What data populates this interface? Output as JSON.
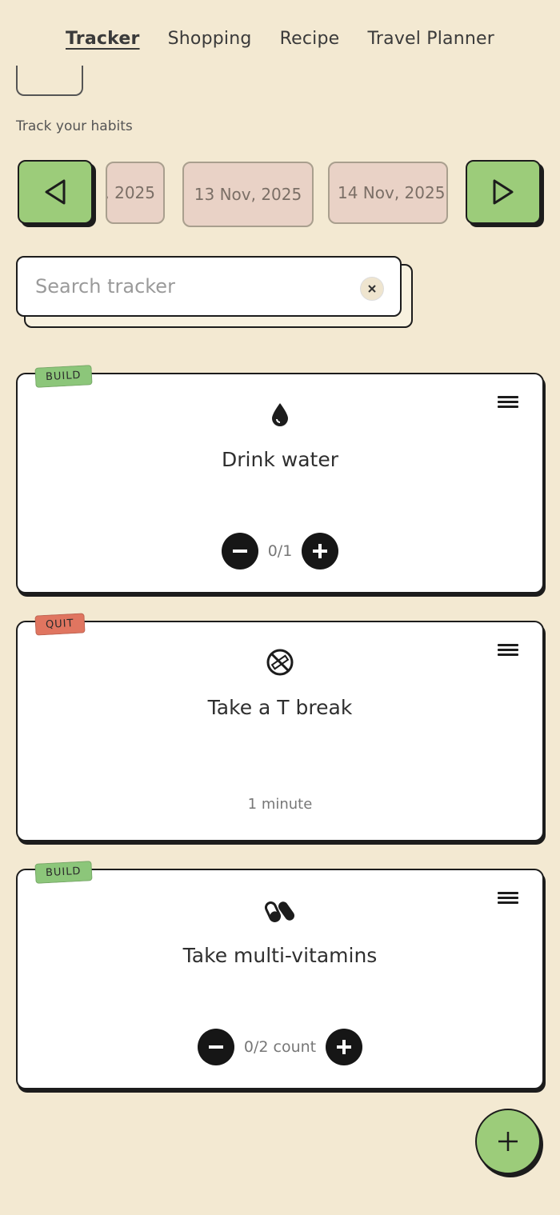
{
  "nav": {
    "tabs": [
      {
        "label": "Tracker",
        "active": true
      },
      {
        "label": "Shopping",
        "active": false
      },
      {
        "label": "Recipe",
        "active": false
      },
      {
        "label": "Travel Planner",
        "active": false
      }
    ]
  },
  "subtitle": "Track your habits",
  "date_strip": {
    "prev_icon": "triangle-left-icon",
    "next_icon": "triangle-right-icon",
    "dates": [
      ", 2025",
      "13 Nov, 2025",
      "14 Nov, 2025"
    ]
  },
  "search": {
    "placeholder": "Search tracker",
    "value": ""
  },
  "habits": [
    {
      "tag": "BUILD",
      "icon": "water-drop-icon",
      "title": "Drink water",
      "progress": "0/1"
    },
    {
      "tag": "QUIT",
      "icon": "no-smoking-icon",
      "title": "Take a T break",
      "duration": "1 minute"
    },
    {
      "tag": "BUILD",
      "icon": "pills-icon",
      "title": "Take multi-vitamins",
      "progress": "0/2 count"
    }
  ],
  "colors": {
    "background": "#f3e9d2",
    "accent_green": "#9ccc7a",
    "build_tag": "#8cc67a",
    "quit_tag": "#e07560",
    "date_chip": "#e9d2c6"
  }
}
